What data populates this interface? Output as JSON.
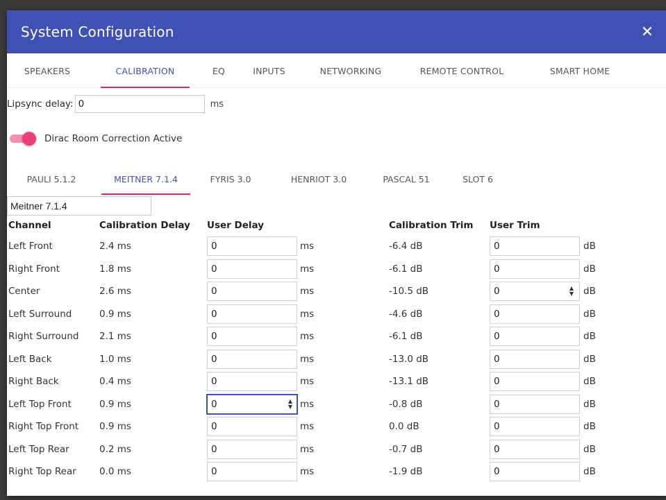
{
  "dialog": {
    "title": "System Configuration",
    "close_label": "✕"
  },
  "tabs": [
    {
      "label": "SPEAKERS",
      "active": false
    },
    {
      "label": "CALIBRATION",
      "active": true
    },
    {
      "label": "EQ",
      "active": false
    },
    {
      "label": "INPUTS",
      "active": false
    },
    {
      "label": "NETWORKING",
      "active": false
    },
    {
      "label": "REMOTE CONTROL",
      "active": false
    },
    {
      "label": "SMART HOME",
      "active": false
    }
  ],
  "lipsync": {
    "label": "Lipsync delay:",
    "value": "0",
    "unit": "ms"
  },
  "dirac": {
    "label": "Dirac Room Correction Active",
    "enabled": true
  },
  "profile_tabs": [
    {
      "label": "PAULI 5.1.2",
      "active": false
    },
    {
      "label": "MEITNER 7.1.4",
      "active": true
    },
    {
      "label": "FYRIS 3.0",
      "active": false
    },
    {
      "label": "HENRIOT 3.0",
      "active": false
    },
    {
      "label": "PASCAL 51",
      "active": false
    },
    {
      "label": "SLOT 6",
      "active": false
    }
  ],
  "profile_name": "Meitner 7.1.4",
  "table": {
    "headers": {
      "channel": "Channel",
      "calibration_delay": "Calibration Delay",
      "user_delay": "User Delay",
      "calibration_trim": "Calibration Trim",
      "user_trim": "User Trim"
    },
    "delay_unit": "ms",
    "trim_unit": "dB",
    "rows": [
      {
        "channel": "Left Front",
        "cal_delay": "2.4 ms",
        "user_delay": "0",
        "cal_trim": "-6.4 dB",
        "user_trim": "0"
      },
      {
        "channel": "Right Front",
        "cal_delay": "1.8 ms",
        "user_delay": "0",
        "cal_trim": "-6.1 dB",
        "user_trim": "0"
      },
      {
        "channel": "Center",
        "cal_delay": "2.6 ms",
        "user_delay": "0",
        "cal_trim": "-10.5 dB",
        "user_trim": "0"
      },
      {
        "channel": "Left Surround",
        "cal_delay": "0.9 ms",
        "user_delay": "0",
        "cal_trim": "-4.6 dB",
        "user_trim": "0"
      },
      {
        "channel": "Right Surround",
        "cal_delay": "2.1 ms",
        "user_delay": "0",
        "cal_trim": "-6.1 dB",
        "user_trim": "0"
      },
      {
        "channel": "Left Back",
        "cal_delay": "1.0 ms",
        "user_delay": "0",
        "cal_trim": "-13.0 dB",
        "user_trim": "0"
      },
      {
        "channel": "Right Back",
        "cal_delay": "0.4 ms",
        "user_delay": "0",
        "cal_trim": "-13.1 dB",
        "user_trim": "0"
      },
      {
        "channel": "Left Top Front",
        "cal_delay": "0.9 ms",
        "user_delay": "0",
        "cal_trim": "-0.8 dB",
        "user_trim": "0"
      },
      {
        "channel": "Right Top Front",
        "cal_delay": "0.9 ms",
        "user_delay": "0",
        "cal_trim": "0.0 dB",
        "user_trim": "0"
      },
      {
        "channel": "Left Top Rear",
        "cal_delay": "0.2 ms",
        "user_delay": "0",
        "cal_trim": "-0.7 dB",
        "user_trim": "0"
      },
      {
        "channel": "Right Top Rear",
        "cal_delay": "0.0 ms",
        "user_delay": "0",
        "cal_trim": "-1.9 dB",
        "user_trim": "0"
      }
    ]
  }
}
